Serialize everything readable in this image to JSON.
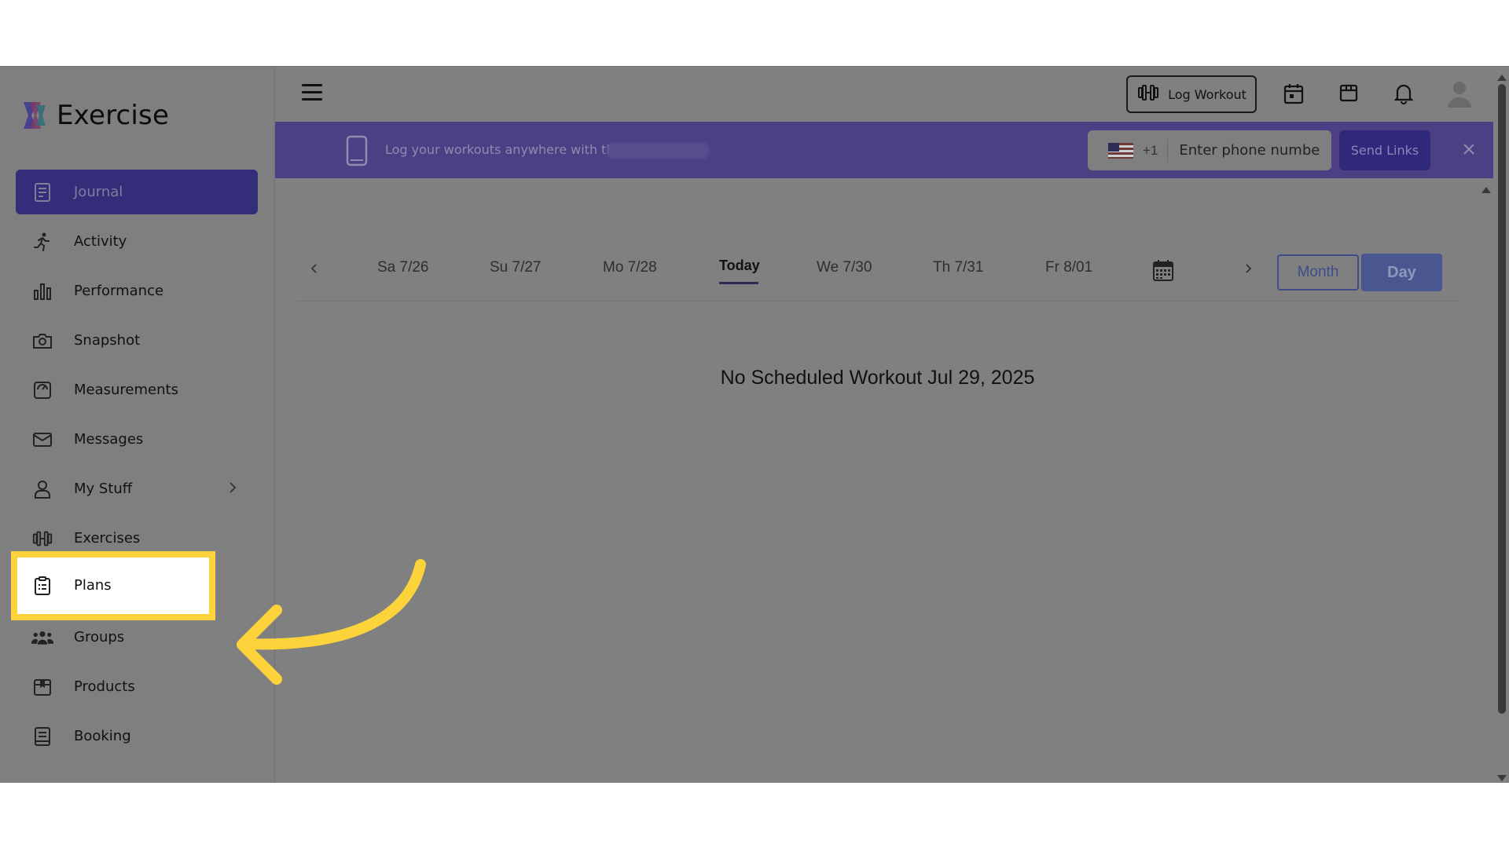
{
  "app": {
    "name": "Exercise"
  },
  "sidebar": {
    "items": [
      {
        "label": "Journal",
        "icon": "journal-icon"
      },
      {
        "label": "Activity",
        "icon": "running-icon"
      },
      {
        "label": "Performance",
        "icon": "bar-chart-icon"
      },
      {
        "label": "Snapshot",
        "icon": "camera-icon"
      },
      {
        "label": "Measurements",
        "icon": "scale-icon"
      },
      {
        "label": "Messages",
        "icon": "mail-icon"
      },
      {
        "label": "My Stuff",
        "icon": "person-icon"
      },
      {
        "label": "Exercises",
        "icon": "dumbbell-icon"
      },
      {
        "label": "Plans",
        "icon": "clipboard-icon"
      },
      {
        "label": "Groups",
        "icon": "group-icon"
      },
      {
        "label": "Products",
        "icon": "product-box-icon"
      },
      {
        "label": "Booking",
        "icon": "booking-icon"
      }
    ],
    "active": "Journal",
    "highlighted": "Plans"
  },
  "topbar": {
    "log_workout_label": "Log Workout"
  },
  "banner": {
    "text": "Log your workouts anywhere with the",
    "country_code": "+1",
    "phone_placeholder": "Enter phone number",
    "send_label": "Send Links"
  },
  "calendar": {
    "days": [
      "Sa 7/26",
      "Su 7/27",
      "Mo 7/28",
      "Today",
      "We 7/30",
      "Th 7/31",
      "Fr 8/01"
    ],
    "view_month_label": "Month",
    "view_day_label": "Day",
    "empty_message": "No Scheduled Workout Jul 29, 2025"
  },
  "colors": {
    "accent": "#332d7a",
    "highlight": "#fcd33a",
    "overlay": "#808080"
  }
}
